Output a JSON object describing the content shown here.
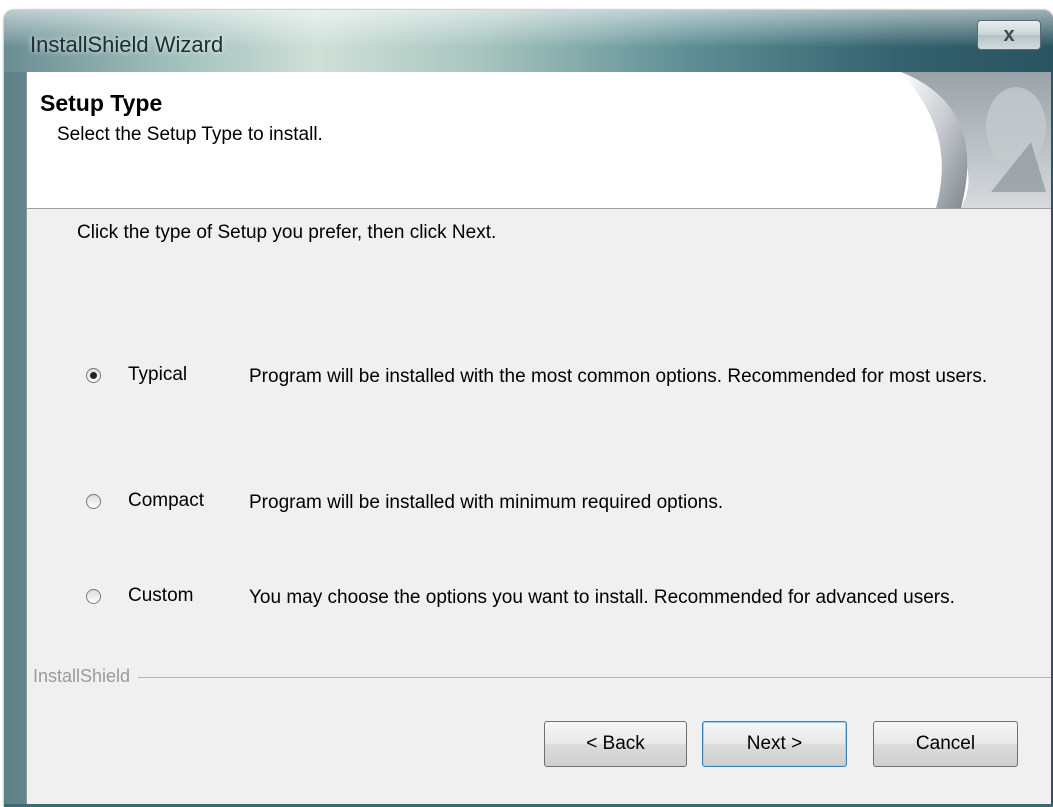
{
  "window": {
    "title": "InstallShield Wizard",
    "close_glyph": "x"
  },
  "header": {
    "title": "Setup Type",
    "subtitle": "Select the Setup Type to install."
  },
  "instruction": "Click the type of Setup you prefer, then click Next.",
  "options": [
    {
      "label": "Typical",
      "description": "Program will be installed with the most common options.  Recommended for most users.",
      "selected": true
    },
    {
      "label": "Compact",
      "description": "Program will be installed with minimum required options.",
      "selected": false
    },
    {
      "label": "Custom",
      "description": "You may choose the options you want to install. Recommended for advanced users.",
      "selected": false
    }
  ],
  "brand": "InstallShield",
  "buttons": {
    "back": "< Back",
    "next": "Next >",
    "cancel": "Cancel"
  },
  "icons": {
    "close": "close-icon",
    "header_art": "page-curl-icon"
  }
}
